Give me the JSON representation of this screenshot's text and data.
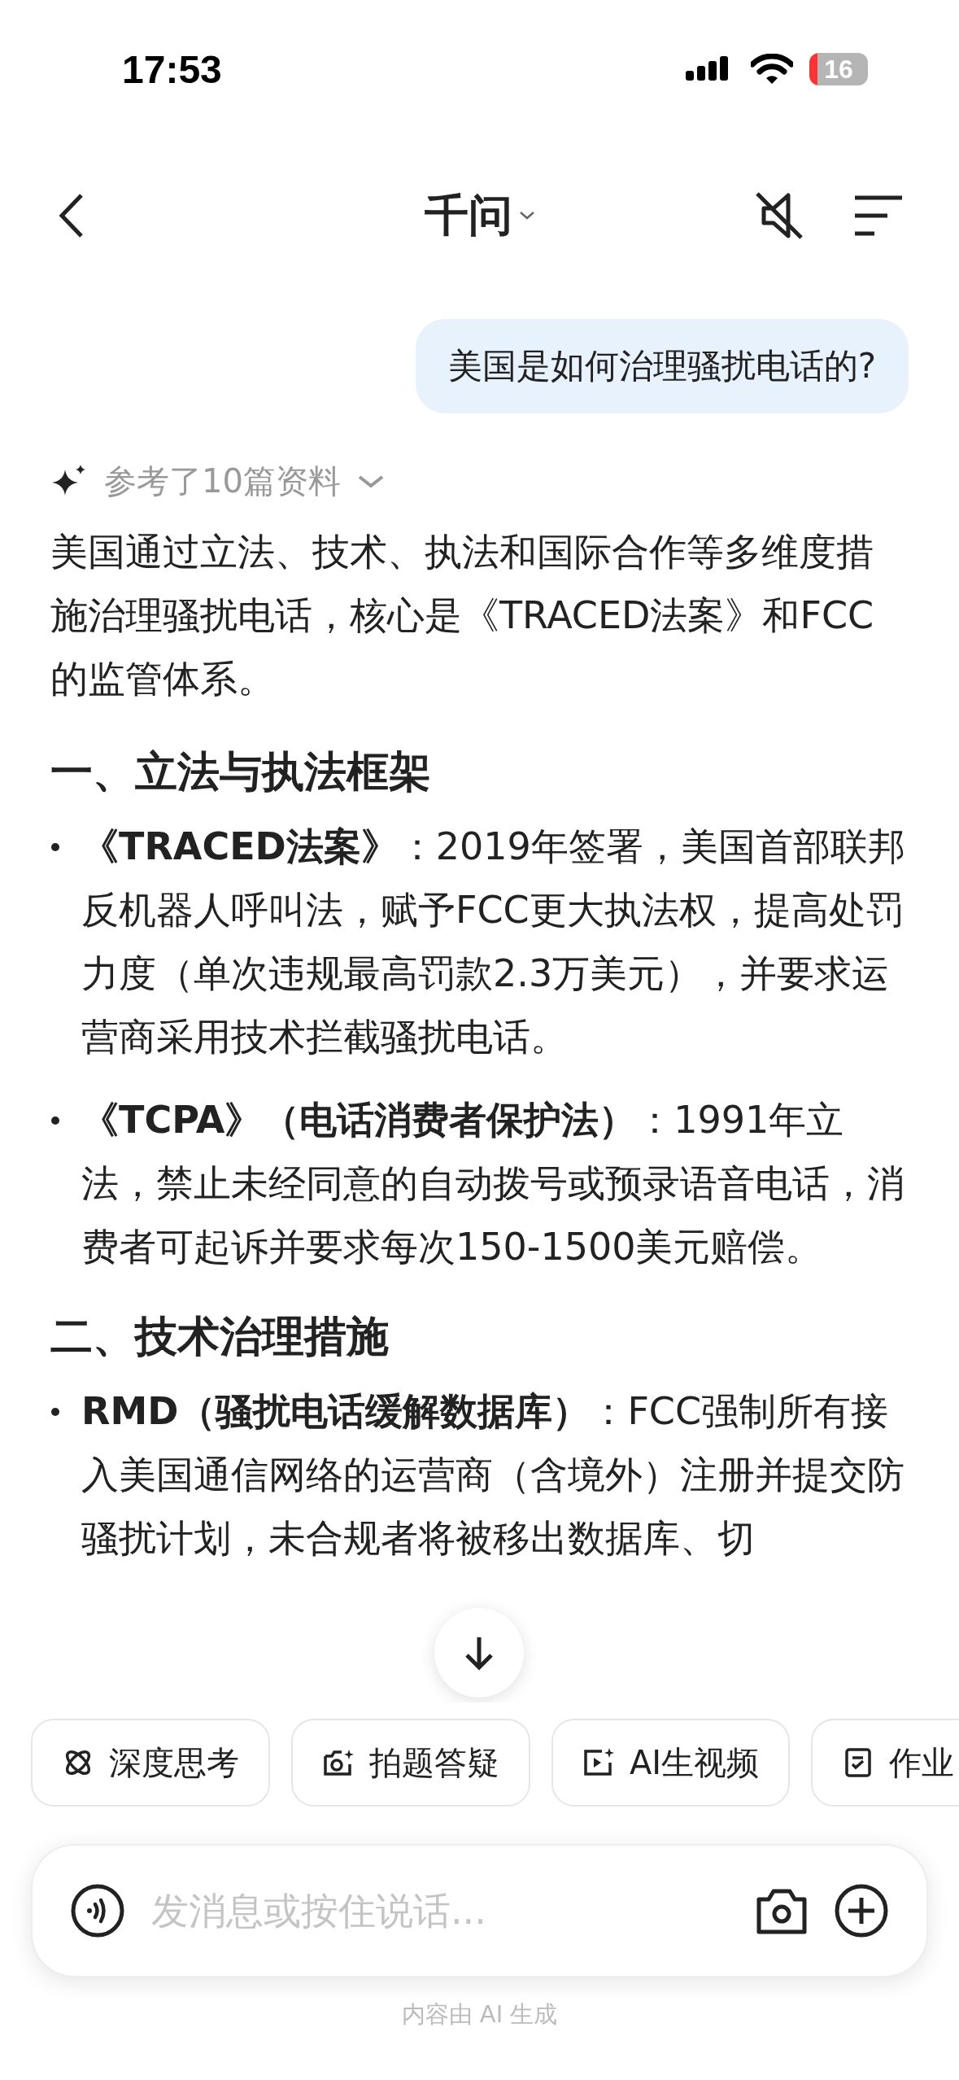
{
  "status_bar": {
    "time": "17:53",
    "battery": "16"
  },
  "nav": {
    "title": "千问"
  },
  "question": "美国是如何治理骚扰电话的?",
  "answer": {
    "sources": "参考了10篇资料",
    "blocks": [
      {
        "kind": "paragraph",
        "text": "美国通过立法、技术、执法和国际合作等多维度措施治理骚扰电话，核心是《TRACED法案》和FCC的监管体系。"
      },
      {
        "kind": "heading",
        "text": "一、立法与执法框架"
      },
      {
        "kind": "bullet",
        "text": "**《TRACED法案》**：2019年签署，美国首部联邦反机器人呼叫法，赋予FCC更大执法权，提高处罚力度（单次违规最高罚款2.3万美元），并要求运营商采用技术拦截骚扰电话。"
      },
      {
        "kind": "bullet",
        "text": "**《TCPA》（电话消费者保护法）**：1991年立法，禁止未经同意的自动拨号或预录语音电话，消费者可起诉并要求每次150-1500美元赔偿。"
      },
      {
        "kind": "heading",
        "text": "二、技术治理措施"
      },
      {
        "kind": "bullet",
        "text": "**RMD（骚扰电话缓解数据库）**：FCC强制所有接入美国通信网络的运营商（含境外）注册并提交防骚扰计划，未合规者将被移出数据库、切"
      }
    ]
  },
  "chips": [
    {
      "kind": "think",
      "label": "深度思考"
    },
    {
      "kind": "photo",
      "label": "拍题答疑"
    },
    {
      "kind": "video",
      "label": "AI生视频"
    },
    {
      "kind": "homework",
      "label": "作业"
    }
  ],
  "input": {
    "placeholder": "发消息或按住说话..."
  },
  "footer": "内容由 AI 生成"
}
